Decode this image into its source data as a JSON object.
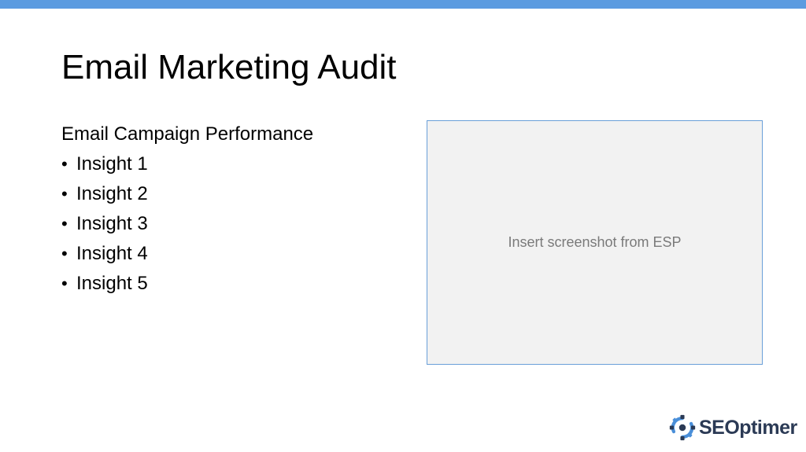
{
  "slide": {
    "title": "Email Marketing Audit",
    "subtitle": "Email Campaign Performance",
    "bullet_glyph": "•",
    "bullets": [
      "Insight 1",
      "Insight 2",
      "Insight 3",
      "Insight 4",
      "Insight 5"
    ],
    "placeholder_text": "Insert screenshot from ESP"
  },
  "logo": {
    "text": "SEOptimer",
    "icon": "seoptimer-gear-icon"
  },
  "colors": {
    "top_bar": "#5b9be0",
    "placeholder_border": "#6a9fd8",
    "placeholder_fill": "#f2f2f2",
    "logo_blue": "#4a8fd9",
    "logo_text": "#2b3a55"
  }
}
